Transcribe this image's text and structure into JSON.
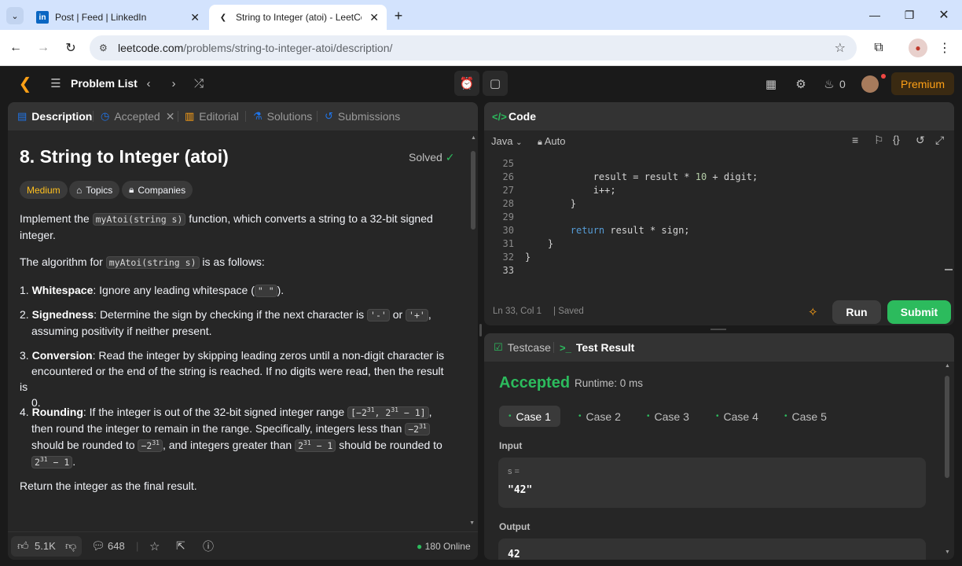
{
  "browser": {
    "tabs": [
      {
        "title": "Post | Feed | LinkedIn",
        "icon": "linkedin-icon"
      },
      {
        "title": "String to Integer (atoi) - LeetCo",
        "icon": "leetcode-icon"
      }
    ],
    "url_host": "leetcode.com",
    "url_path": "/problems/string-to-integer-atoi/description/"
  },
  "nav": {
    "problem_list": "Problem List",
    "streak": "0",
    "premium": "Premium"
  },
  "left_panel": {
    "tabs": [
      "Description",
      "Accepted",
      "Editorial",
      "Solutions",
      "Submissions"
    ],
    "title": "8. String to Integer (atoi)",
    "solved": "Solved",
    "difficulty": "Medium",
    "topics": "Topics",
    "companies": "Companies",
    "intro_1": "Implement the",
    "intro_code": "myAtoi(string s)",
    "intro_2": "function, which converts a string to a 32-bit signed",
    "intro_3": "integer.",
    "algo_1": "The algorithm for",
    "algo_code": "myAtoi(string s)",
    "algo_2": "is as follows:",
    "steps": {
      "s1_num": "1.",
      "s1_bold": "Whitespace",
      "s1_text": ": Ignore any leading whitespace (",
      "s1_code": "\" \"",
      "s1_end": ").",
      "s2_num": "2.",
      "s2_bold": "Signedness",
      "s2_text": ": Determine the sign by checking if the next character is",
      "s2_code1": "'-'",
      "s2_or": "or",
      "s2_code2": "'+'",
      "s2_end": ",",
      "s2_line2": "assuming positivity if neither present.",
      "s3_num": "3.",
      "s3_bold": "Conversion",
      "s3_text": ": Read the integer by skipping leading zeros until a non-digit character is",
      "s3_line2": "encountered or the end of the string is reached. If no digits were read, then the result is",
      "s3_line3": "0.",
      "s4_num": "4.",
      "s4_bold": "Rounding",
      "s4_text": ": If the integer is out of the 32-bit signed integer range",
      "s4_line2": "then round the integer to remain in the range. Specifically, integers less than",
      "s4_line3a": "should be rounded to",
      "s4_line3b": ", and integers greater than",
      "s4_line3c": "should be rounded to"
    },
    "final": "Return the integer as the final result.",
    "footer": {
      "likes": "5.1K",
      "comments": "648",
      "online": "180 Online"
    }
  },
  "code_panel": {
    "title": "Code",
    "language": "Java",
    "auto": "Auto",
    "lines": [
      {
        "n": "25",
        "t": ""
      },
      {
        "n": "26",
        "t": "            result = result * 10 + digit;"
      },
      {
        "n": "27",
        "t": "            i++;"
      },
      {
        "n": "28",
        "t": "        }"
      },
      {
        "n": "29",
        "t": ""
      },
      {
        "n": "30",
        "t": "        return result * sign;"
      },
      {
        "n": "31",
        "t": "    }"
      },
      {
        "n": "32",
        "t": "}"
      },
      {
        "n": "33",
        "t": ""
      }
    ],
    "status": "Ln 33, Col 1",
    "saved": "Saved",
    "run": "Run",
    "submit": "Submit"
  },
  "test_panel": {
    "testcase": "Testcase",
    "test_result": "Test Result",
    "result": "Accepted",
    "runtime": "Runtime: 0 ms",
    "cases": [
      "Case 1",
      "Case 2",
      "Case 3",
      "Case 4",
      "Case 5"
    ],
    "input_label": "Input",
    "input_var": "s =",
    "input_value": "\"42\"",
    "output_label": "Output",
    "output_value": "42"
  },
  "colors": {
    "accent": "#ffa116",
    "success": "#2cbb5d",
    "link": "#1f74e9"
  }
}
